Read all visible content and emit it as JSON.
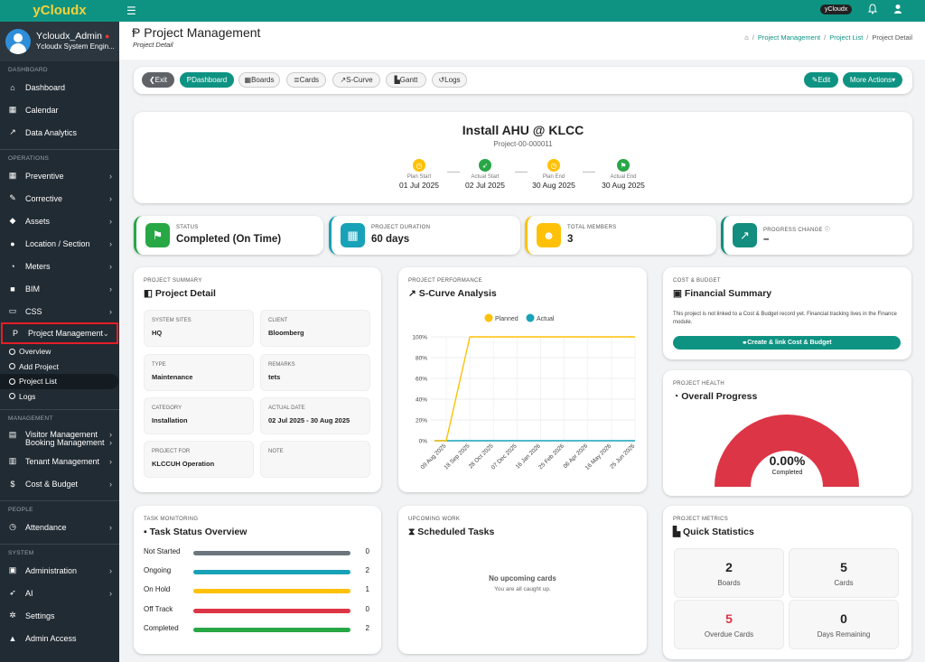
{
  "app": {
    "brand": "yCloudx"
  },
  "user": {
    "name": "Ycloudx_Admin",
    "role": "Ycloudx System Engin..."
  },
  "sidebar": {
    "dashboard_label": "DASHBOARD",
    "dashboard_items": [
      {
        "label": "Dashboard",
        "icon": "home-icon"
      },
      {
        "label": "Calendar",
        "icon": "calendar-icon"
      },
      {
        "label": "Data Analytics",
        "icon": "chart-line-icon"
      }
    ],
    "operations_label": "OPERATIONS",
    "operations_items": [
      {
        "label": "Preventive"
      },
      {
        "label": "Corrective"
      },
      {
        "label": "Assets"
      },
      {
        "label": "Location / Section"
      },
      {
        "label": "Meters"
      },
      {
        "label": "BIM"
      },
      {
        "label": "CSS"
      },
      {
        "label": "Project Management"
      }
    ],
    "pm_sub": [
      "Overview",
      "Add Project",
      "Project List",
      "Logs"
    ],
    "management_label": "MANAGEMENT",
    "management_items": [
      {
        "label": "Visitor Management"
      },
      {
        "label": "Booking Management"
      },
      {
        "label": "Tenant Management"
      },
      {
        "label": "Cost & Budget"
      }
    ],
    "people_label": "PEOPLE",
    "people_items": [
      {
        "label": "Attendance"
      }
    ],
    "system_label": "SYSTEM",
    "system_items": [
      {
        "label": "Administration"
      },
      {
        "label": "AI"
      },
      {
        "label": "Settings"
      },
      {
        "label": "Admin Access"
      }
    ]
  },
  "topbar": {
    "tenant": "yCloudx"
  },
  "header": {
    "title": "Project Management",
    "subtitle": "Project Detail",
    "crumbs": [
      "Project Management",
      "Project List",
      "Project Detail"
    ]
  },
  "toolbar": {
    "exit": "Exit",
    "dashboard": "Dashboard",
    "boards": "Boards",
    "cards": "Cards",
    "scurve": "S-Curve",
    "gantt": "Gantt",
    "logs": "Logs",
    "edit": "Edit",
    "more": "More Actions"
  },
  "project": {
    "title": "Install AHU @ KLCC",
    "id": "Project-00-000011",
    "timeline": [
      {
        "label": "Plan Start",
        "date": "01 Jul 2025"
      },
      {
        "label": "Actual Start",
        "date": "02 Jul 2025"
      },
      {
        "label": "Plan End",
        "date": "30 Aug 2025"
      },
      {
        "label": "Actual End",
        "date": "30 Aug 2025"
      }
    ]
  },
  "stats": [
    {
      "label": "STATUS",
      "value": "Completed (On Time)",
      "color": "#28a745"
    },
    {
      "label": "PROJECT DURATION",
      "value": "60 days",
      "color": "#17a2b8"
    },
    {
      "label": "TOTAL MEMBERS",
      "value": "3",
      "color": "#ffc107"
    },
    {
      "label": "PROGRESS CHANGE",
      "value": "–",
      "color": "#138d7e"
    }
  ],
  "summary": {
    "kicker": "PROJECT SUMMARY",
    "title": "Project Detail",
    "fields": [
      {
        "label": "SYSTEM SITES",
        "value": "HQ"
      },
      {
        "label": "CLIENT",
        "value": "Bloomberg"
      },
      {
        "label": "TYPE",
        "value": "Maintenance"
      },
      {
        "label": "REMARKS",
        "value": "tets"
      },
      {
        "label": "CATEGORY",
        "value": "Installation"
      },
      {
        "label": "ACTUAL DATE",
        "value": "02 Jul 2025 - 30 Aug 2025"
      },
      {
        "label": "PROJECT FOR",
        "value": "KLCCUH Operation"
      },
      {
        "label": "NOTE",
        "value": ""
      }
    ]
  },
  "performance": {
    "kicker": "PROJECT PERFORMANCE",
    "title": "S-Curve Analysis"
  },
  "chart_data": {
    "type": "line",
    "x": [
      "09 Aug 2025",
      "18 Sep 2025",
      "28 Oct 2025",
      "07 Dec 2025",
      "16 Jan 2026",
      "25 Feb 2026",
      "06 Apr 2026",
      "16 May 2026",
      "25 Jun 2026"
    ],
    "yticks": [
      "0%",
      "20%",
      "40%",
      "60%",
      "80%",
      "100%"
    ],
    "ylim": [
      0,
      100
    ],
    "series": [
      {
        "name": "Planned",
        "color": "#ffc107",
        "values": [
          0,
          100,
          100,
          100,
          100,
          100,
          100,
          100,
          100
        ]
      },
      {
        "name": "Actual",
        "color": "#17a2b8",
        "values": [
          0,
          0,
          0,
          0,
          0,
          0,
          0,
          0,
          0
        ]
      }
    ],
    "legend": "top",
    "grid": true
  },
  "cost": {
    "kicker": "COST & BUDGET",
    "title": "Financial Summary",
    "text": "This project is not linked to a Cost & Budget record yet. Financial tracking lives in the Finance module.",
    "button": "Create & link Cost & Budget"
  },
  "health": {
    "kicker": "PROJECT HEALTH",
    "title": "Overall Progress",
    "value": "0.00%",
    "label": "Completed",
    "progress": 0
  },
  "tasks": {
    "kicker": "TASK MONITORING",
    "title": "Task Status Overview",
    "rows": [
      {
        "label": "Not Started",
        "count": "0",
        "color": "#6c757d"
      },
      {
        "label": "Ongoing",
        "count": "2",
        "color": "#17a2b8"
      },
      {
        "label": "On Hold",
        "count": "1",
        "color": "#ffc107"
      },
      {
        "label": "Off Track",
        "count": "0",
        "color": "#dc3545"
      },
      {
        "label": "Completed",
        "count": "2",
        "color": "#28a745"
      }
    ]
  },
  "upcoming": {
    "kicker": "UPCOMING WORK",
    "title": "Scheduled Tasks",
    "empty": "No upcoming cards",
    "sub": "You are all caught up."
  },
  "metrics": {
    "kicker": "PROJECT METRICS",
    "title": "Quick Statistics",
    "items": [
      {
        "value": "2",
        "label": "Boards"
      },
      {
        "value": "5",
        "label": "Cards"
      },
      {
        "value": "5",
        "label": "Overdue Cards"
      },
      {
        "value": "0",
        "label": "Days Remaining"
      }
    ]
  }
}
